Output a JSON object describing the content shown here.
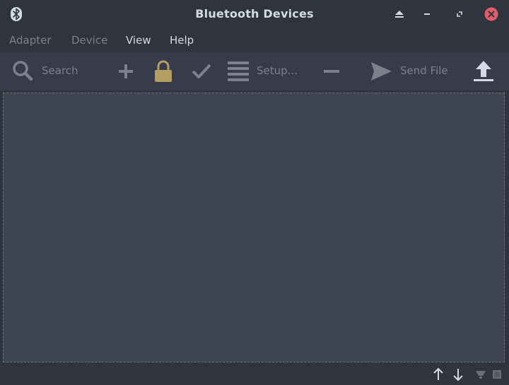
{
  "window": {
    "title": "Bluetooth Devices"
  },
  "titlebar_buttons": {
    "shade": "shade-icon",
    "minimize": "minimize-icon",
    "maximize": "maximize-icon",
    "close": "close-icon"
  },
  "menubar": {
    "items": [
      {
        "label": "Adapter",
        "enabled": false
      },
      {
        "label": "Device",
        "enabled": false
      },
      {
        "label": "View",
        "enabled": true
      },
      {
        "label": "Help",
        "enabled": true
      }
    ]
  },
  "toolbar": {
    "search_label": "Search",
    "setup_label": "Setup...",
    "send_file_label": "Send File",
    "icons": {
      "search": "search-icon",
      "add": "plus-icon",
      "pair": "lock-icon",
      "trust": "checkmark-icon",
      "setup": "list-icon",
      "remove": "minus-icon",
      "send": "send-icon",
      "upload": "upload-icon"
    }
  },
  "device_list": {
    "rows": []
  },
  "statusbar": {
    "icons": [
      "arrow-up-icon",
      "arrow-down-icon",
      "network-icon",
      "power-icon"
    ]
  },
  "colors": {
    "window_bg": "#2f343f",
    "toolbar_bg": "#383c4a",
    "list_bg": "#404552",
    "text": "#d3dae3",
    "text_disabled": "#7c818c",
    "close_red": "#e25c6b",
    "lock_gold": "#b3a060"
  }
}
